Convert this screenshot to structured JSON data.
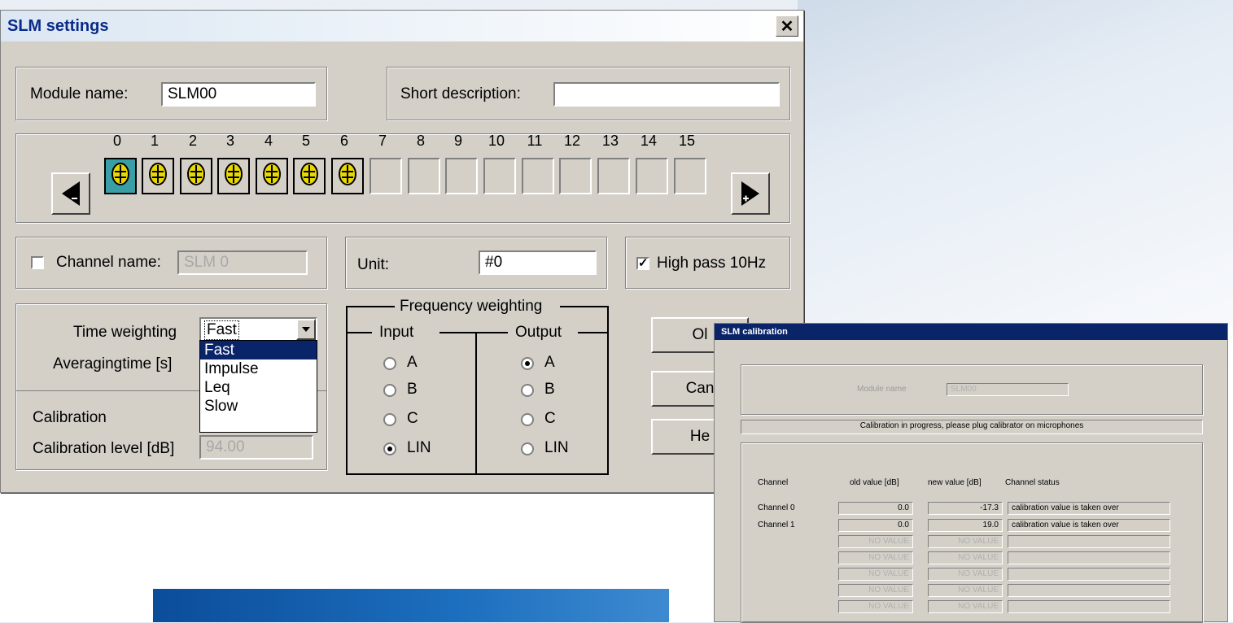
{
  "settings": {
    "title": "SLM settings",
    "close_label": "✕",
    "module_name_label": "Module name:",
    "module_name_value": "SLM00",
    "short_desc_label": "Short description:",
    "short_desc_value": "",
    "channel_numbers": [
      "0",
      "1",
      "2",
      "3",
      "4",
      "5",
      "6",
      "7",
      "8",
      "9",
      "10",
      "11",
      "12",
      "13",
      "14",
      "15"
    ],
    "channel_name_label": "Channel name:",
    "channel_name_value": "SLM 0",
    "channel_name_checked": false,
    "unit_label": "Unit:",
    "unit_value": "#0",
    "highpass_label": "High pass 10Hz",
    "highpass_checked": true,
    "time_weighting_label": "Time weighting",
    "time_weighting_value": "Fast",
    "averaging_label": "Averagingtime [s]",
    "dropdown_options": [
      "Fast",
      "Impulse",
      "Leq",
      "Slow"
    ],
    "calibration_label": "Calibration",
    "calibration_level_label": "Calibration level [dB]",
    "calibration_level_value": "94.00",
    "freq_weighting_label": "Frequency weighting",
    "input_label": "Input",
    "output_label": "Output",
    "input_options": [
      "A",
      "B",
      "C",
      "LIN"
    ],
    "input_selected": "LIN",
    "output_options": [
      "A",
      "B",
      "C",
      "LIN"
    ],
    "output_selected": "A",
    "ok_label": "Ol",
    "cancel_label": "Can",
    "help_label": "He"
  },
  "calibration": {
    "title": "SLM calibration",
    "progress_text": "Calibration in progress, please plug calibrator on microphones",
    "col_channel": "Channel",
    "col_old": "old value [dB]",
    "col_new": "new value [dB]",
    "col_status": "Channel status",
    "rows": [
      {
        "channel": "Channel  0",
        "old": "0.0",
        "new": "-17.3",
        "status": "calibration value is taken over"
      },
      {
        "channel": "Channel  1",
        "old": "0.0",
        "new": "19.0",
        "status": "calibration value is taken over"
      }
    ],
    "novalue_text": "NO VALUE"
  },
  "colors": {
    "dialog_face": "#d4d0c8",
    "title_text": "#0a2a8a",
    "selection": "#0a246a",
    "active_slot": "#3a9ea6"
  }
}
